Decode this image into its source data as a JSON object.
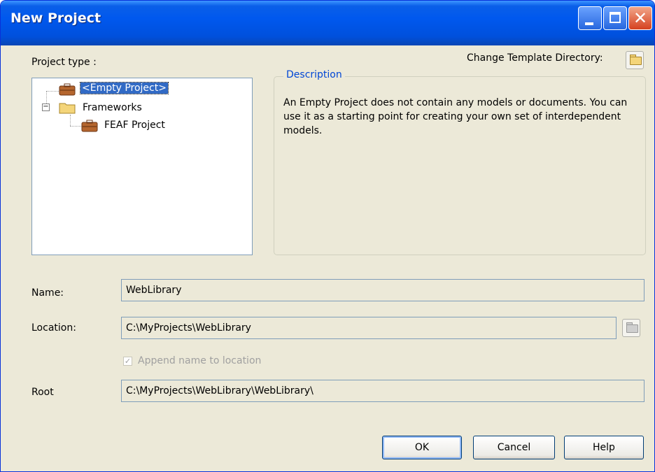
{
  "window": {
    "title": "New Project"
  },
  "project_type_label": "Project type :",
  "change_template_label": "Change Template Directory:",
  "tree": {
    "items": [
      {
        "label": "<Empty Project>",
        "icon": "briefcase-icon",
        "selected": true
      },
      {
        "label": "Frameworks",
        "icon": "folder-icon",
        "expanded": true
      },
      {
        "label": "FEAF Project",
        "icon": "briefcase-icon"
      }
    ]
  },
  "description": {
    "title": "Description",
    "text": "An Empty Project does not contain any models or documents. You can use it as a starting point for creating your own set of interdependent models."
  },
  "form": {
    "name_label": "Name:",
    "name_value": "WebLibrary",
    "location_label": "Location:",
    "location_value": "C:\\MyProjects\\WebLibrary",
    "append_label": "Append name to location",
    "append_checked": true,
    "root_label": "Root",
    "root_value": "C:\\MyProjects\\WebLibrary\\WebLibrary\\"
  },
  "buttons": {
    "ok": "OK",
    "cancel": "Cancel",
    "help": "Help"
  },
  "colors": {
    "titlebar": "#0058ee",
    "face": "#ece9d8",
    "selection": "#316ac5",
    "groupbox_title": "#0046d5"
  }
}
